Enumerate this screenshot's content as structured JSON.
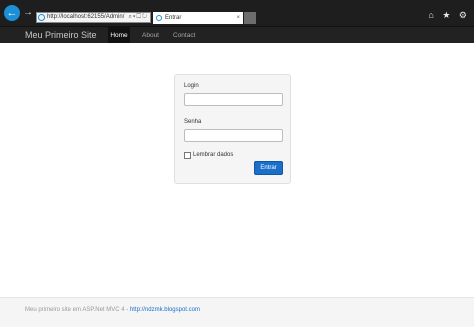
{
  "browser": {
    "address": "http://localhost:62155/Admin/",
    "tab_title": "Entrar",
    "tab_close": "×",
    "right_icons": "⌂ ★ ⚙"
  },
  "navbar": {
    "brand": "Meu Primeiro Site",
    "items": [
      {
        "label": "Home"
      },
      {
        "label": "About"
      },
      {
        "label": "Contact"
      }
    ]
  },
  "login": {
    "login_label": "Login",
    "login_value": "",
    "senha_label": "Senha",
    "senha_value": "",
    "remember_label": "Lembrar dados",
    "submit_label": "Entrar"
  },
  "footer": {
    "text": "Meu primeiro site em ASP.Net MVC 4 - ",
    "link": "http://ndzmk.blogspot.com"
  },
  "colors": {
    "accent": "#1a6fc9",
    "navbar": "#222222",
    "browser_back": "#1d8fd6"
  }
}
